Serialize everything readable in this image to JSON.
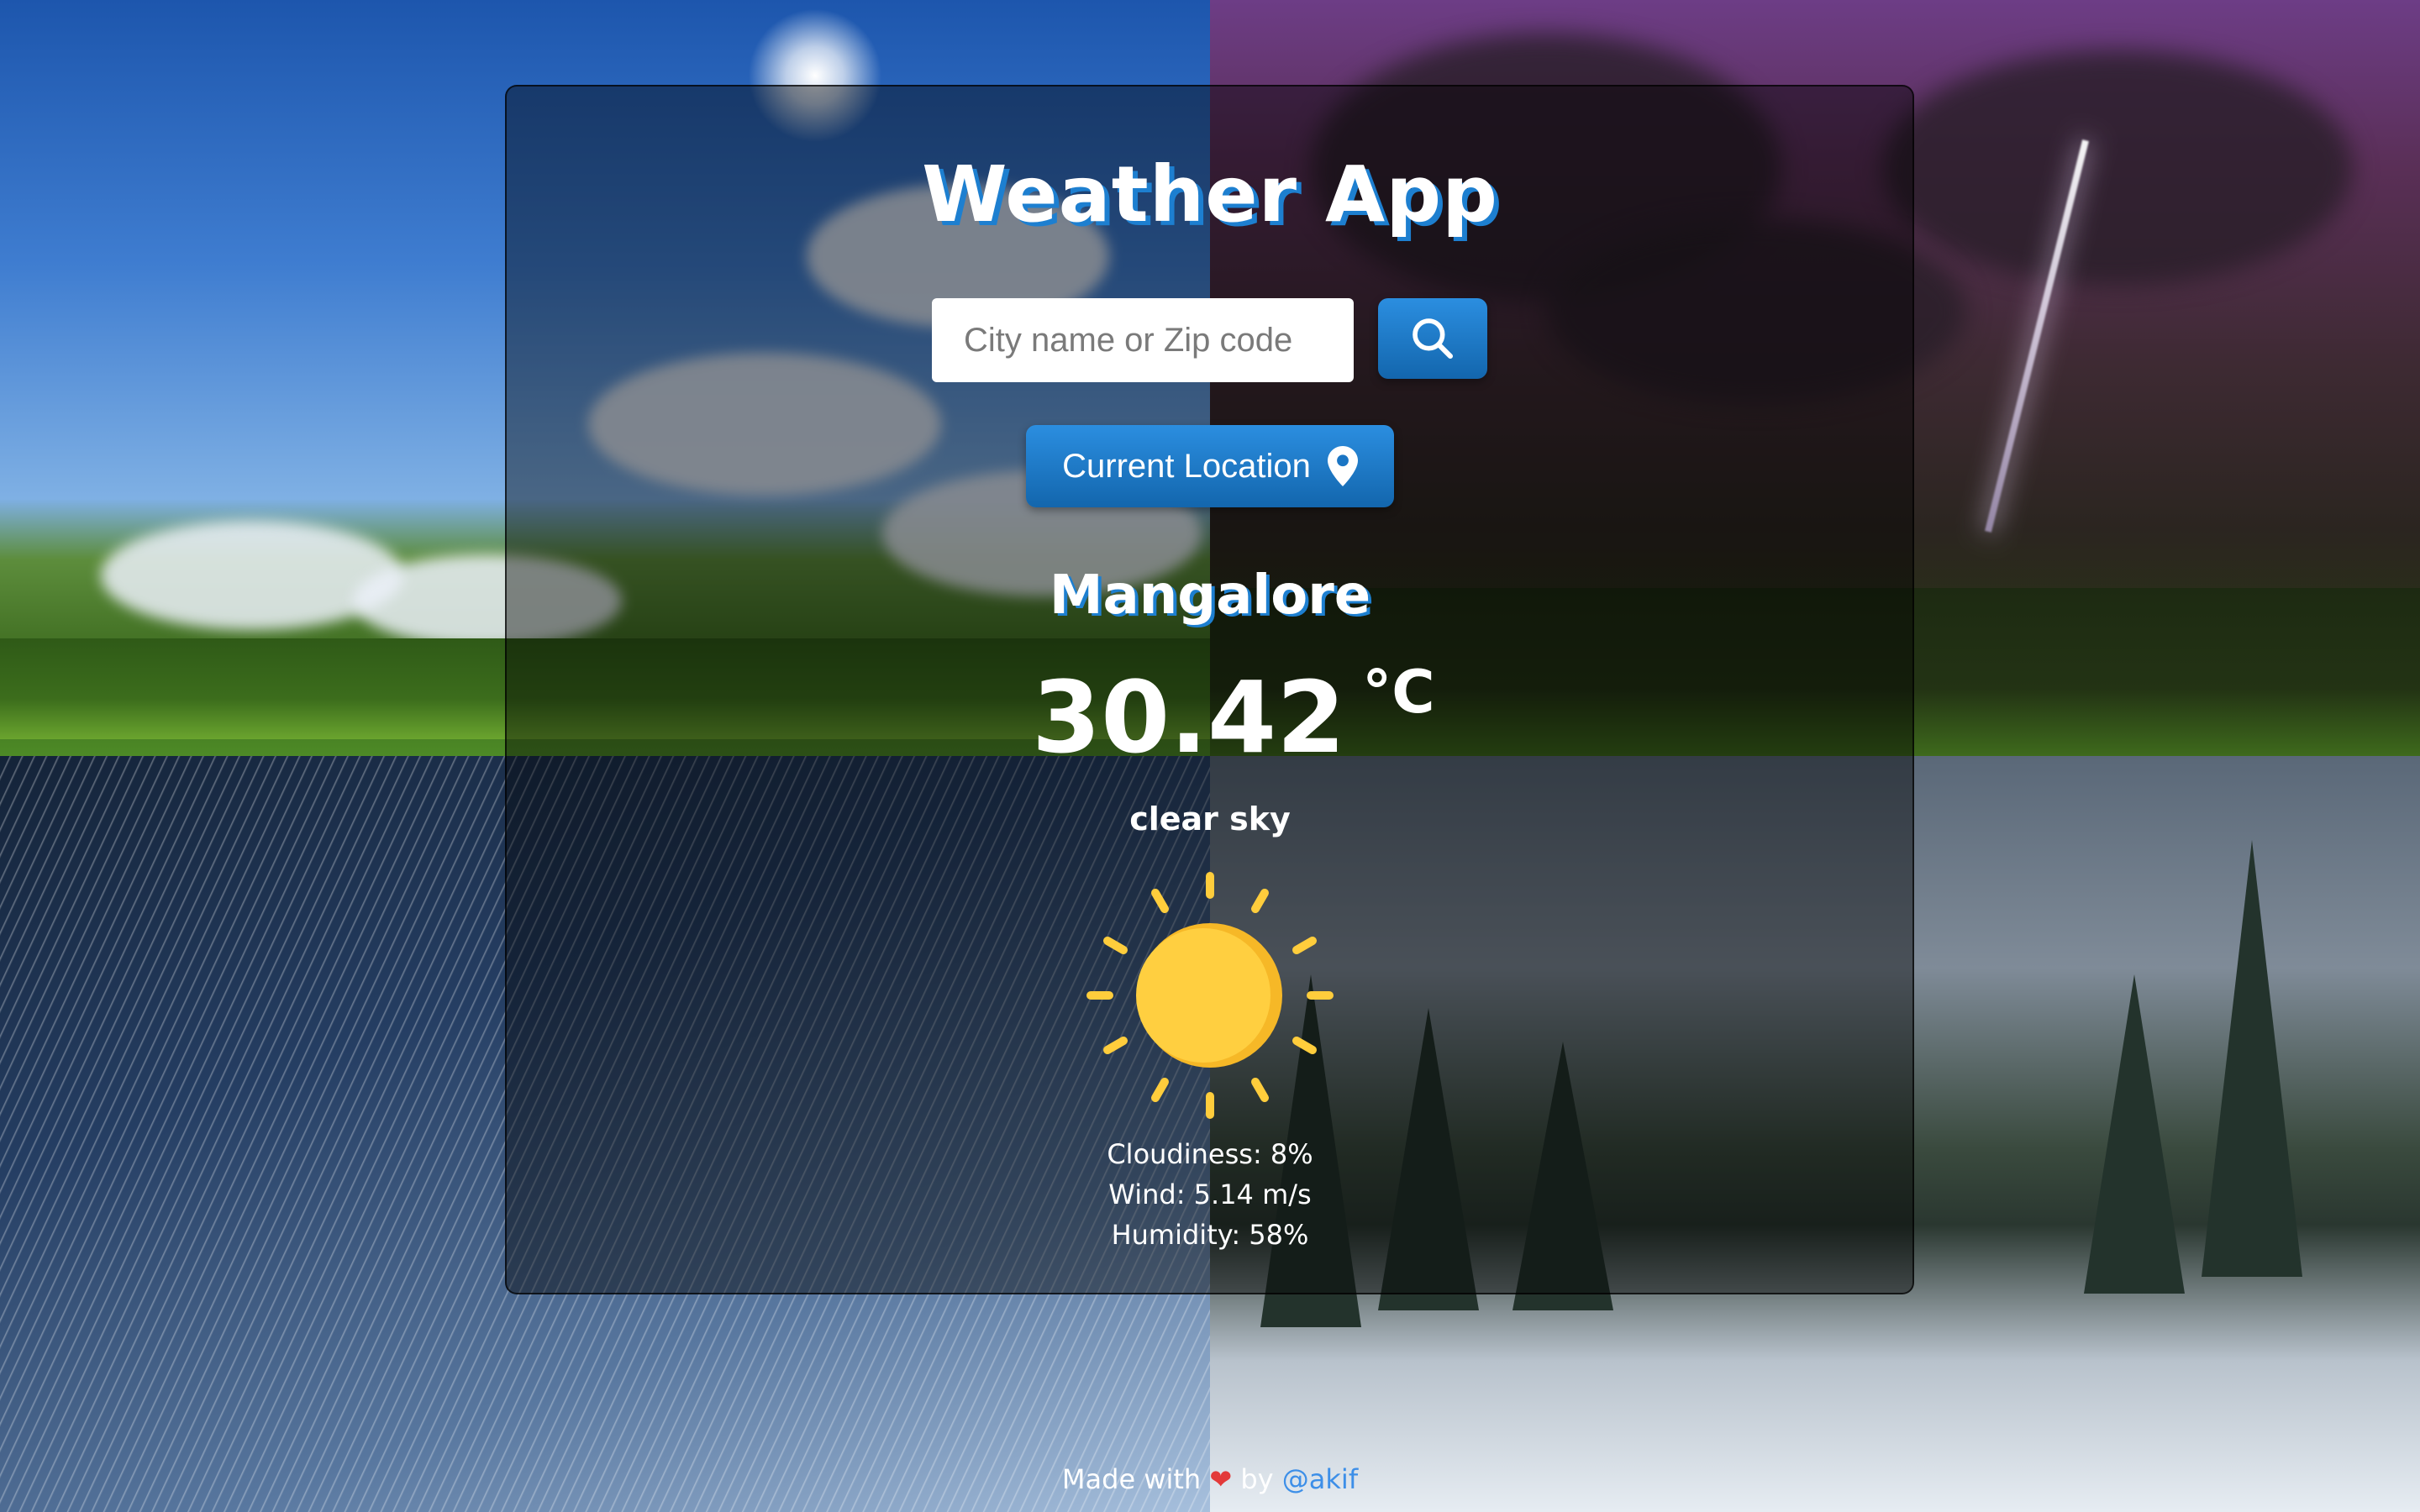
{
  "app": {
    "title": "Weather App"
  },
  "search": {
    "placeholder": "City name or Zip code",
    "value": "",
    "button_icon": "search-icon"
  },
  "location_button": {
    "label": "Current Location",
    "icon": "map-pin-icon"
  },
  "weather": {
    "city": "Mangalore",
    "temperature": "30.42",
    "unit": "°C",
    "description": "clear sky",
    "icon": "sun-icon",
    "details": [
      "Cloudiness: 8%",
      "Wind: 5.14 m/s",
      "Humidity: 58%"
    ]
  },
  "footer": {
    "prefix": "Made with",
    "heart": "❤",
    "by": "by",
    "author": "@akif"
  },
  "colors": {
    "accent": "#1d7fd0",
    "button_top": "#2b8ee0",
    "button_bottom": "#1366ad",
    "sun": "#ffcd3c",
    "heart": "#e33a3a"
  }
}
